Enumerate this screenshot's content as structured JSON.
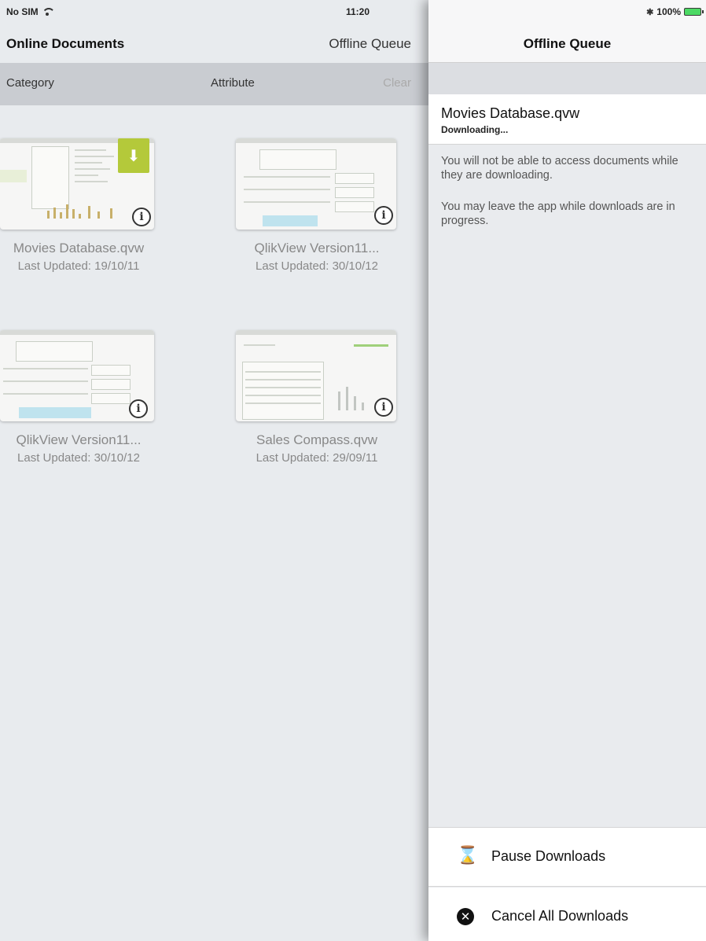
{
  "status_bar": {
    "carrier": "No SIM",
    "time": "11:20",
    "battery": "100%"
  },
  "main": {
    "title": "Online Documents",
    "offline_queue_button": "Offline Queue",
    "filters": {
      "category": "Category",
      "attribute": "Attribute",
      "clear": "Clear"
    },
    "documents": [
      {
        "name": "Movies Database.qvw",
        "date": "Last Updated: 19/10/11"
      },
      {
        "name": "QlikView Version11...",
        "date": "Last Updated: 30/10/12"
      },
      {
        "name": "QlikView Version11...",
        "date": "Last Updated: 30/10/12"
      },
      {
        "name": "Sales Compass.qvw",
        "date": "Last Updated: 29/09/11"
      }
    ]
  },
  "panel": {
    "title": "Offline Queue",
    "queue_item": {
      "name": "Movies Database.qvw",
      "status": "Downloading..."
    },
    "notes": [
      "You will not be able to access documents while they are downloading.",
      "You may leave the app while downloads are in progress."
    ],
    "actions": {
      "pause": "Pause Downloads",
      "cancel": "Cancel All Downloads"
    }
  },
  "colors": {
    "download_badge": "#b4c93a",
    "battery": "#4cd964",
    "filter_bar": "#c9ccd1"
  }
}
